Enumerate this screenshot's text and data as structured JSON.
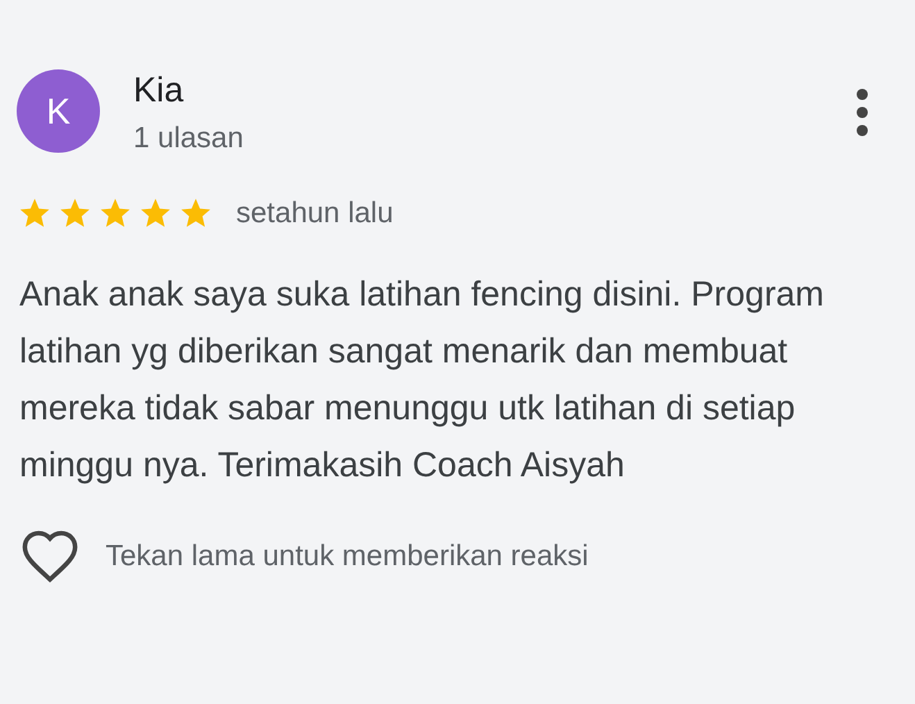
{
  "review": {
    "avatar_letter": "K",
    "author": "Kia",
    "review_count": "1 ulasan",
    "stars": 5,
    "time": "setahun lalu",
    "text": "Anak anak saya suka latihan fencing disini. Program latihan yg diberikan sangat menarik dan membuat mereka tidak sabar menunggu utk latihan di setiap minggu nya. Terimakasih Coach Aisyah",
    "reaction_hint": "Tekan lama untuk memberikan reaksi"
  }
}
